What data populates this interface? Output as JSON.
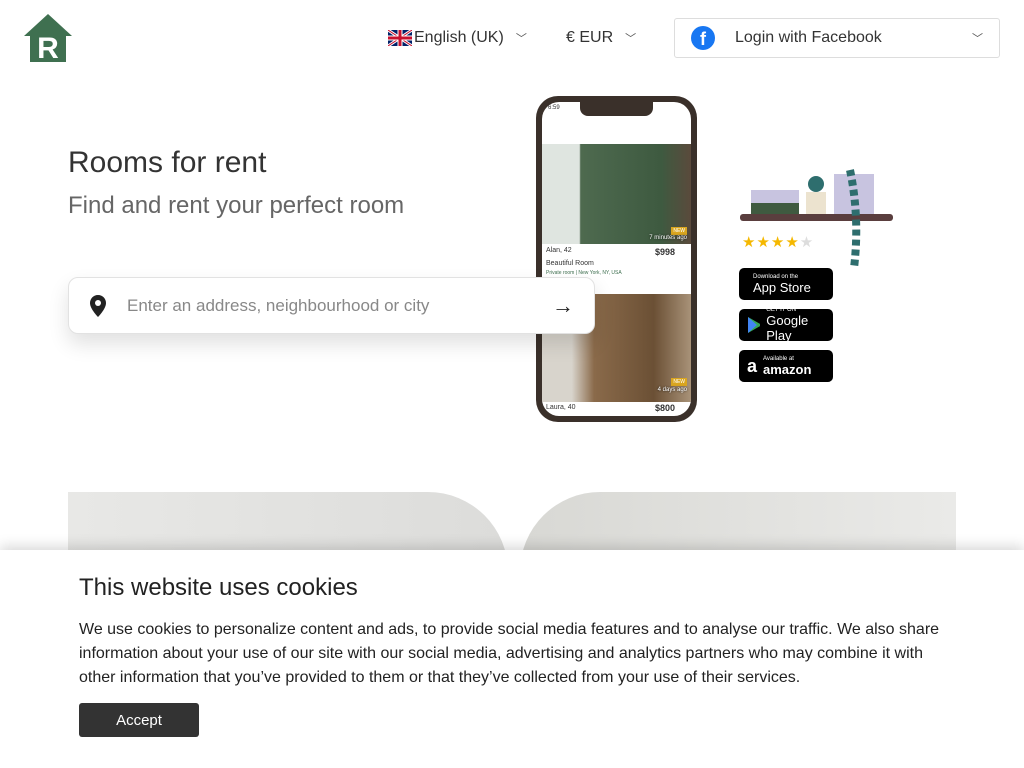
{
  "header": {
    "language": "English (UK)",
    "currency": "€ EUR",
    "login": "Login with Facebook"
  },
  "hero": {
    "title": "Rooms for rent",
    "subtitle": "Find and rent your perfect room",
    "search": {
      "placeholder": "Enter an address, neighbourhood or city",
      "value": ""
    }
  },
  "phone": {
    "time": "6:59",
    "listings": [
      {
        "name": "Alan, 42",
        "price": "$998",
        "title": "Beautiful Room",
        "details": "Private room | New York, NY, USA",
        "posted": "7 minutes ago",
        "tag": "NEW"
      },
      {
        "name": "Laura, 40",
        "price": "$800",
        "posted": "4 days ago",
        "tag": "NEW"
      }
    ]
  },
  "rating": 4.5,
  "stores": [
    {
      "small": "Download on the",
      "big": "App Store",
      "icon": "apple-icon"
    },
    {
      "small": "GET IT ON",
      "big": "Google Play",
      "icon": "google-play-icon"
    },
    {
      "small": "Available at",
      "big": "amazon",
      "icon": "amazon-icon"
    }
  ],
  "cookie": {
    "title": "This website uses cookies",
    "text": "We use cookies to personalize content and ads, to provide social media features and to analyse our traffic. We also share information about your use of our site with our social media, advertising and analytics partners who may combine it with other information that you’ve provided to them or that they’ve collected from your use of their services.",
    "accept": "Accept"
  },
  "colors": {
    "brand": "#3f7050",
    "facebook": "#1877f2",
    "accept": "#333333"
  }
}
